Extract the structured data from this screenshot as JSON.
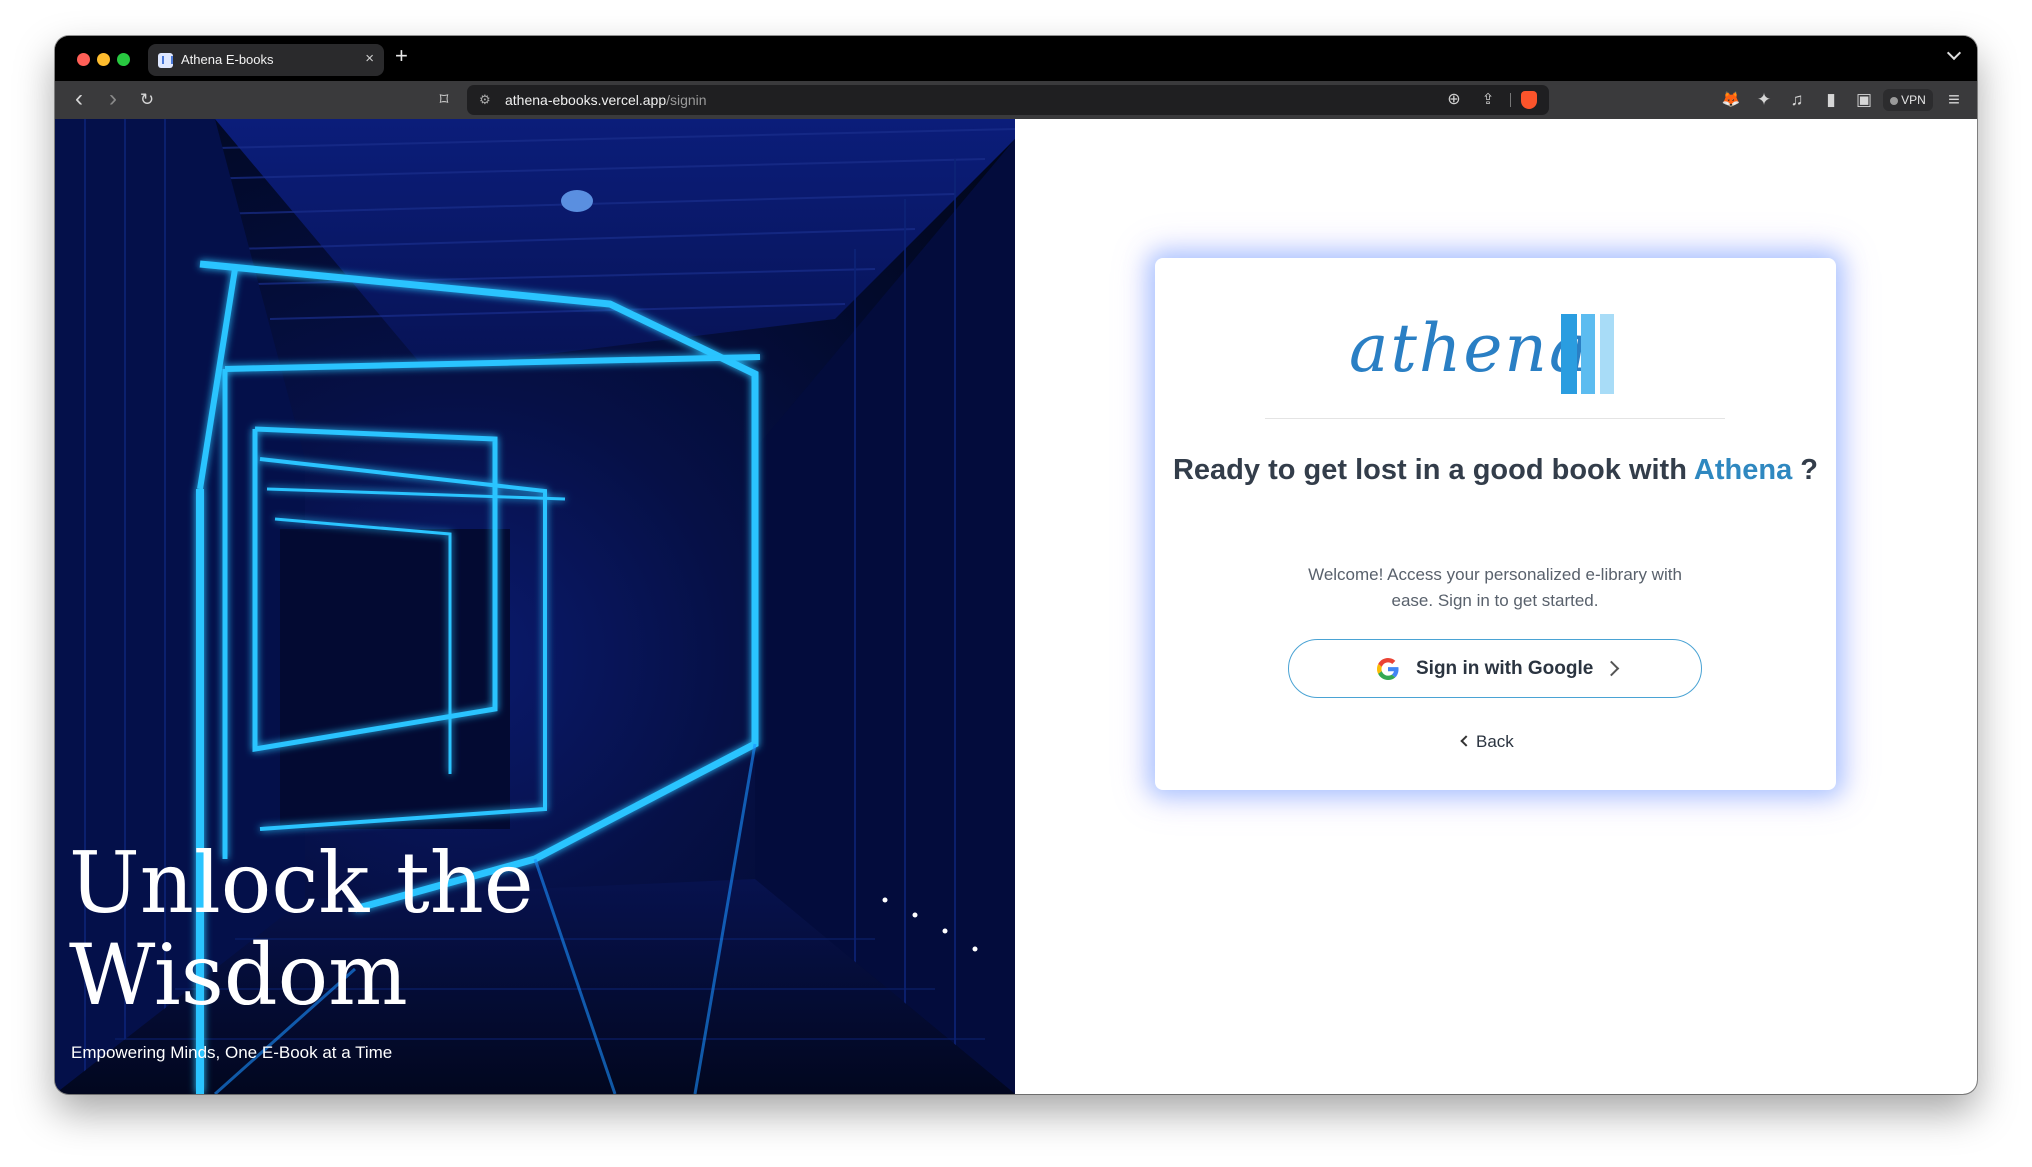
{
  "browser": {
    "tab_title": "Athena E-books",
    "tab_close": "×",
    "new_tab": "+",
    "url_host": "athena-ebooks.vercel.app",
    "url_path": "/signin",
    "vpn_label": "VPN"
  },
  "toolbar_icons": {
    "back": "‹",
    "forward": "›",
    "reload": "↻",
    "bookmark": "⌑",
    "site_settings": "⚙",
    "zoom": "⊕",
    "share": "⇪",
    "extensions": "✦",
    "media": "♫",
    "sidebar": "▮",
    "wallet": "▣",
    "menu": "≡",
    "metamask": "🦊"
  },
  "hero": {
    "title": "Unlock the Wisdom",
    "subtitle": "Empowering Minds, One E-Book at a Time"
  },
  "card": {
    "logo_text": "athena",
    "heading_part1": "Ready to get lost in a good book with ",
    "heading_brand": "Athena",
    "heading_part2": " ?",
    "description": "Welcome! Access your personalized e-library with ease. Sign in to get started.",
    "google_button_label": "Sign in with Google",
    "back_label": "Back"
  },
  "colors": {
    "brand_blue": "#2f88c0",
    "button_border": "#4aa3d4",
    "hero_glow": "#1e90ff"
  }
}
